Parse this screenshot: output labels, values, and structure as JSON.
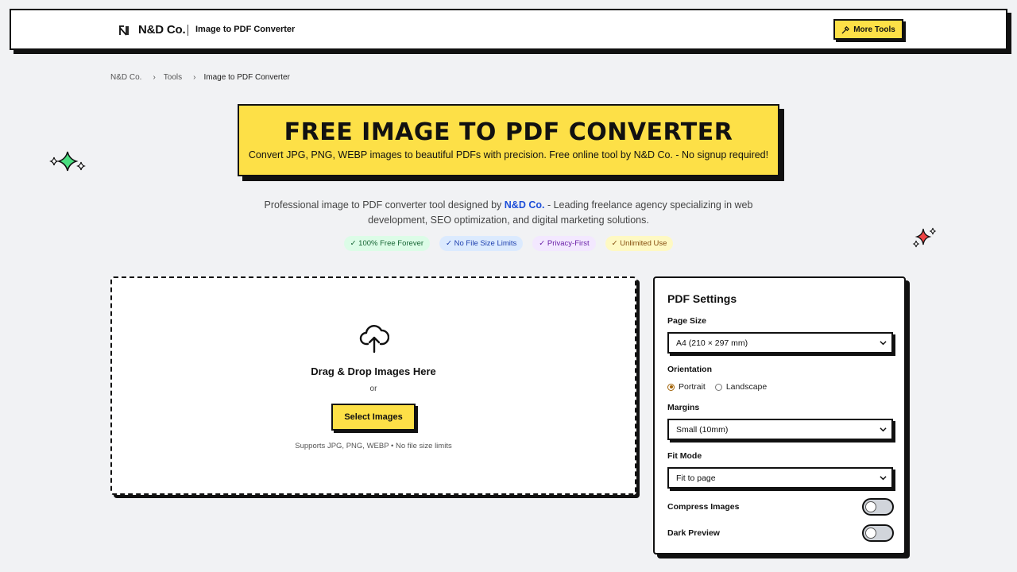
{
  "header": {
    "brand": "N&D Co.",
    "title": "Image to PDF Converter",
    "more_tools_label": "More Tools"
  },
  "breadcrumb": [
    "N&D Co.",
    "Tools",
    "Image to PDF Converter"
  ],
  "hero": {
    "title": "FREE IMAGE TO PDF CONVERTER",
    "subtitle": "Convert JPG, PNG, WEBP images to beautiful PDFs with precision. Free online tool by N&D Co. - No signup required!"
  },
  "intro": {
    "prefix": "Professional image to PDF converter tool designed by ",
    "brand": "N&D Co.",
    "suffix": " - Leading freelance agency specializing in web development, SEO optimization, and digital marketing solutions."
  },
  "badges": [
    "✓ 100% Free Forever",
    "✓ No File Size Limits",
    "✓ Privacy-First",
    "✓ Unlimited Use"
  ],
  "dropzone": {
    "title": "Drag & Drop Images Here",
    "or": "or",
    "button": "Select Images",
    "hint": "Supports JPG, PNG, WEBP • No file size limits"
  },
  "settings": {
    "title": "PDF Settings",
    "page_size_label": "Page Size",
    "page_size_value": "A4 (210 × 297 mm)",
    "orientation_label": "Orientation",
    "orientation_options": [
      "Portrait",
      "Landscape"
    ],
    "orientation_selected": "Portrait",
    "margins_label": "Margins",
    "margins_value": "Small (10mm)",
    "fit_label": "Fit Mode",
    "fit_value": "Fit to page",
    "compress_label": "Compress Images",
    "compress_on": false,
    "dark_label": "Dark Preview",
    "dark_on": false
  },
  "colors": {
    "accent_yellow": "#fde047",
    "link_blue": "#1d4ed8",
    "background": "#f1f2f4"
  }
}
